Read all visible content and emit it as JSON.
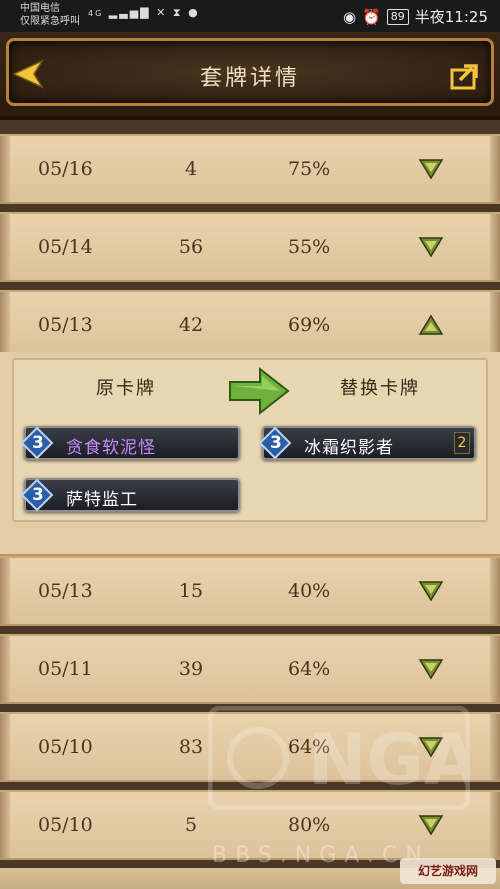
{
  "status_bar": {
    "carrier_line1": "中国电信",
    "carrier_line2": "仅限紧急呼叫",
    "network": "4G",
    "battery": "89",
    "time": "半夜11:25",
    "icons": [
      "signal-icon",
      "wifi-icon",
      "hourglass-icon",
      "qq-icon",
      "eye-icon",
      "alarm-icon"
    ]
  },
  "header": {
    "title": "套牌详情",
    "back_icon": "back-arrow-icon",
    "share_icon": "share-icon"
  },
  "rows": [
    {
      "date": "05/16",
      "count": "4",
      "percent": "75%",
      "trend": "down"
    },
    {
      "date": "05/14",
      "count": "56",
      "percent": "55%",
      "trend": "down"
    },
    {
      "date": "05/13",
      "count": "42",
      "percent": "69%",
      "trend": "up"
    },
    {
      "date": "05/13",
      "count": "15",
      "percent": "40%",
      "trend": "down"
    },
    {
      "date": "05/11",
      "count": "39",
      "percent": "64%",
      "trend": "down"
    },
    {
      "date": "05/10",
      "count": "83",
      "percent": "64%",
      "trend": "down"
    },
    {
      "date": "05/10",
      "count": "5",
      "percent": "80%",
      "trend": "down"
    }
  ],
  "detail_panel": {
    "left_title": "原卡牌",
    "right_title": "替换卡牌",
    "original_cards": [
      {
        "cost": "3",
        "name": "贪食软泥怪",
        "color": "#c58cff"
      },
      {
        "cost": "3",
        "name": "萨特监工",
        "color": "#ffffff"
      }
    ],
    "replacement_cards": [
      {
        "cost": "3",
        "name": "冰霜织影者",
        "color": "#ffffff",
        "count": "2"
      }
    ]
  },
  "watermark": {
    "brand": "NGA",
    "url": "BBS.NGA.CN",
    "site_logo": "幻艺游戏网"
  },
  "colors": {
    "row_bg": "#e4cca3",
    "text": "#4a3320",
    "trend_arrow": "#6c7d2a",
    "header_title": "#f0e0c2"
  }
}
